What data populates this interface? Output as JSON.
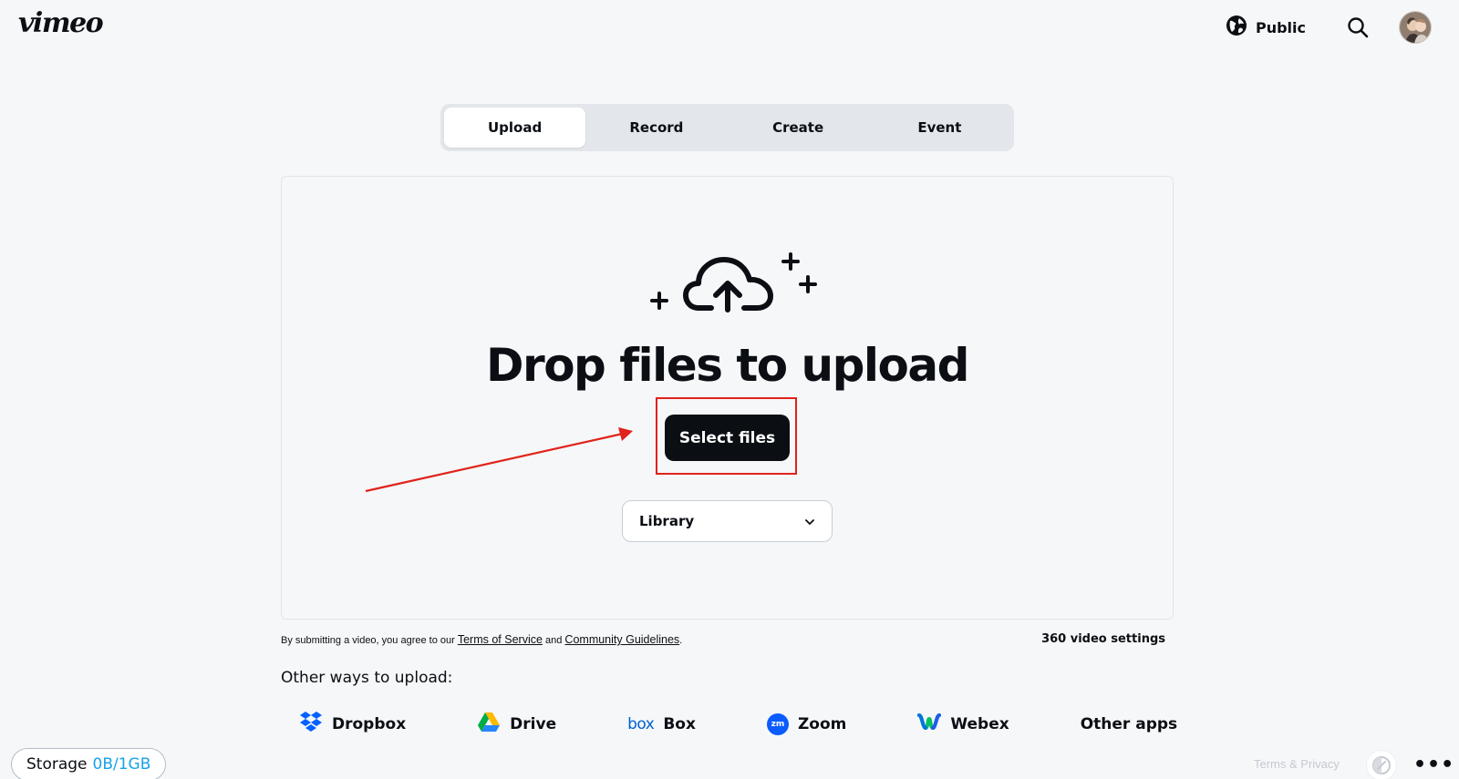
{
  "header": {
    "logo": "vimeo",
    "privacy_label": "Public"
  },
  "tabs": [
    {
      "label": "Upload",
      "active": true
    },
    {
      "label": "Record",
      "active": false
    },
    {
      "label": "Create",
      "active": false
    },
    {
      "label": "Event",
      "active": false
    }
  ],
  "dropzone": {
    "title": "Drop files to upload",
    "select_button": "Select files",
    "folder_select": "Library"
  },
  "terms": {
    "prefix": "By submitting a video, you agree to our",
    "tos": "Terms of Service",
    "and": "and",
    "guidelines": "Community Guidelines",
    "suffix": "."
  },
  "video_360_label": "360 video settings",
  "other_ways": {
    "heading": "Other ways to upload:",
    "providers": [
      {
        "name": "Dropbox",
        "icon": "dropbox-icon"
      },
      {
        "name": "Drive",
        "icon": "google-drive-icon"
      },
      {
        "name": "Box",
        "icon": "box-icon",
        "icon_text": "box"
      },
      {
        "name": "Zoom",
        "icon": "zoom-icon",
        "icon_text": "zm"
      },
      {
        "name": "Webex",
        "icon": "webex-icon"
      },
      {
        "name": "Other apps",
        "icon": ""
      }
    ]
  },
  "footer": {
    "storage_label": "Storage",
    "storage_value": "0B/1GB",
    "terms_privacy": "Terms & Privacy",
    "more_label": "•••"
  },
  "colors": {
    "accent_red": "#e0231b",
    "storage_blue": "#17a2e8",
    "button_dark": "#0b0f14"
  }
}
